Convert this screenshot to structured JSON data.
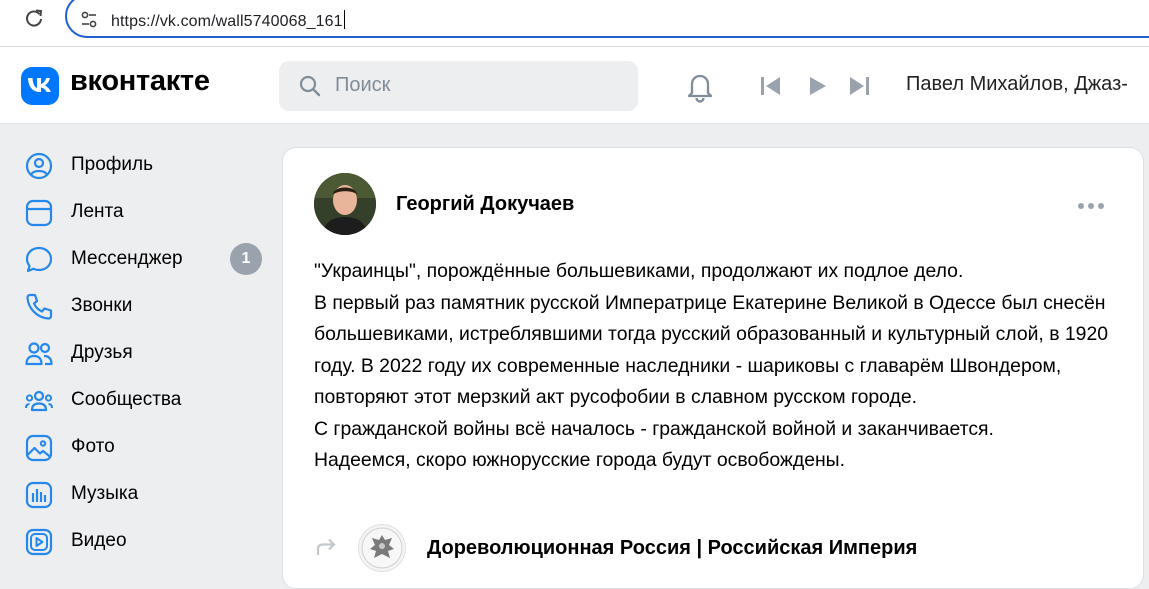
{
  "browser": {
    "url": "https://vk.com/wall5740068_161"
  },
  "header": {
    "logo_text": "вконтакте",
    "search_placeholder": "Поиск",
    "now_playing": "Павел Михайлов, Джаз-"
  },
  "sidebar": {
    "items": [
      {
        "label": "Профиль",
        "icon": "profile-icon"
      },
      {
        "label": "Лента",
        "icon": "feed-icon"
      },
      {
        "label": "Мессенджер",
        "icon": "messenger-icon",
        "badge": "1"
      },
      {
        "label": "Звонки",
        "icon": "phone-icon"
      },
      {
        "label": "Друзья",
        "icon": "friends-icon"
      },
      {
        "label": "Сообщества",
        "icon": "communities-icon"
      },
      {
        "label": "Фото",
        "icon": "photo-icon"
      },
      {
        "label": "Музыка",
        "icon": "music-icon"
      },
      {
        "label": "Видео",
        "icon": "video-icon"
      }
    ]
  },
  "post": {
    "author": "Георгий Докучаев",
    "lines": [
      "\"Украинцы\", порождённые большевиками, продолжают их подлое дело.",
      "В первый раз памятник русской Императрице Екатерине Великой в Одессе был снесён большевиками, истреблявшими тогда русский образованный и культурный слой, в 1920 году. В 2022 году их современные наследники - шариковы с главарём Швондером, повторяют этот мерзкий акт русофобии в славном русском городе.",
      "С гражданской войны всё началось - гражданской войной и заканчивается.",
      "Надеемся, скоро южнорусские города будут освобождены."
    ],
    "repost_source": "Дореволюционная Россия | Российская Империя"
  },
  "colors": {
    "accent": "#0077ff",
    "badge": "#99a2ad",
    "icon": "#2688eb",
    "background": "#edeef0"
  }
}
